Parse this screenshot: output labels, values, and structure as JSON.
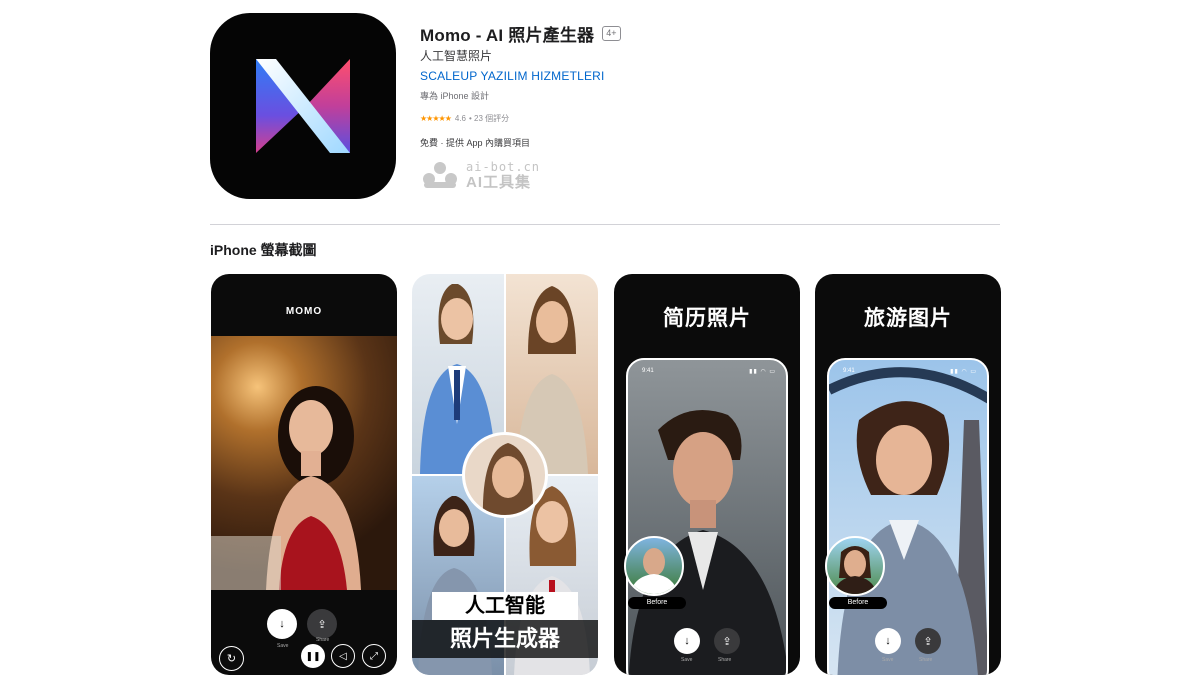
{
  "app": {
    "title": "Momo - AI 照片產生器",
    "age_rating": "4+",
    "subtitle": "人工智慧照片",
    "developer": "SCALEUP YAZILIM HIZMETLERI",
    "designed_for": "專為 iPhone 設計",
    "stars": "★★★★★",
    "rating": "4.6",
    "rating_count": "• 23 個評分",
    "price": "免費 · 提供 App 內購買項目"
  },
  "watermark": {
    "url": "ai-bot.cn",
    "name": "AI工具集"
  },
  "section": {
    "title": "iPhone 螢幕截圖"
  },
  "screenshots": [
    {
      "logo": "MOMO",
      "save_label": "Save",
      "share_label": "Share"
    },
    {
      "banner_line1": "人工智能",
      "banner_line2": "照片生成器"
    },
    {
      "headline": "简历照片",
      "time": "9:41",
      "before_label": "Before",
      "save_label": "Save",
      "share_label": "Share"
    },
    {
      "headline": "旅游图片",
      "time": "9:41",
      "before_label": "Before",
      "save_label": "Save",
      "share_label": "Share"
    }
  ],
  "icons": [
    "app-logo-icon",
    "watermark-logo-icon",
    "download-icon",
    "share-icon",
    "replay-icon",
    "pause-icon",
    "mute-icon",
    "expand-icon"
  ]
}
